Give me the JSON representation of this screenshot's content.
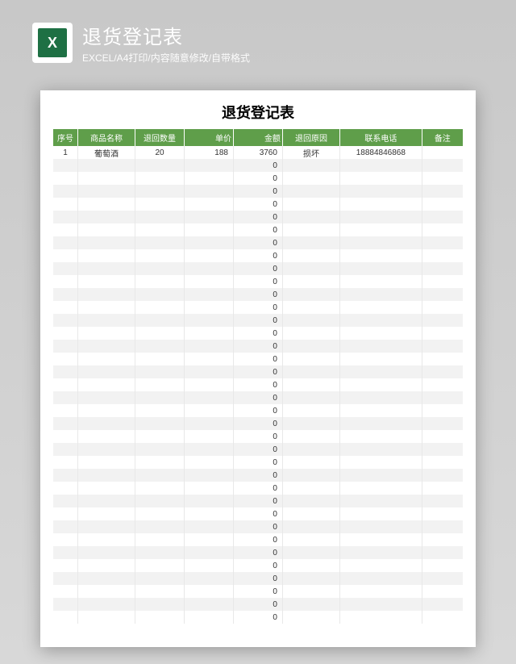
{
  "header": {
    "icon_text": "X",
    "title": "退货登记表",
    "subtitle": "EXCEL/A4打印/内容随意修改/自带格式"
  },
  "table": {
    "title": "退货登记表",
    "columns": [
      "序号",
      "商品名称",
      "退回数量",
      "单价",
      "金额",
      "退回原因",
      "联系电话",
      "备注"
    ],
    "rows": [
      {
        "seq": "1",
        "name": "葡萄酒",
        "qty": "20",
        "price": "188",
        "amount": "3760",
        "reason": "损坏",
        "phone": "18884846868",
        "note": ""
      },
      {
        "seq": "",
        "name": "",
        "qty": "",
        "price": "",
        "amount": "0",
        "reason": "",
        "phone": "",
        "note": ""
      },
      {
        "seq": "",
        "name": "",
        "qty": "",
        "price": "",
        "amount": "0",
        "reason": "",
        "phone": "",
        "note": ""
      },
      {
        "seq": "",
        "name": "",
        "qty": "",
        "price": "",
        "amount": "0",
        "reason": "",
        "phone": "",
        "note": ""
      },
      {
        "seq": "",
        "name": "",
        "qty": "",
        "price": "",
        "amount": "0",
        "reason": "",
        "phone": "",
        "note": ""
      },
      {
        "seq": "",
        "name": "",
        "qty": "",
        "price": "",
        "amount": "0",
        "reason": "",
        "phone": "",
        "note": ""
      },
      {
        "seq": "",
        "name": "",
        "qty": "",
        "price": "",
        "amount": "0",
        "reason": "",
        "phone": "",
        "note": ""
      },
      {
        "seq": "",
        "name": "",
        "qty": "",
        "price": "",
        "amount": "0",
        "reason": "",
        "phone": "",
        "note": ""
      },
      {
        "seq": "",
        "name": "",
        "qty": "",
        "price": "",
        "amount": "0",
        "reason": "",
        "phone": "",
        "note": ""
      },
      {
        "seq": "",
        "name": "",
        "qty": "",
        "price": "",
        "amount": "0",
        "reason": "",
        "phone": "",
        "note": ""
      },
      {
        "seq": "",
        "name": "",
        "qty": "",
        "price": "",
        "amount": "0",
        "reason": "",
        "phone": "",
        "note": ""
      },
      {
        "seq": "",
        "name": "",
        "qty": "",
        "price": "",
        "amount": "0",
        "reason": "",
        "phone": "",
        "note": ""
      },
      {
        "seq": "",
        "name": "",
        "qty": "",
        "price": "",
        "amount": "0",
        "reason": "",
        "phone": "",
        "note": ""
      },
      {
        "seq": "",
        "name": "",
        "qty": "",
        "price": "",
        "amount": "0",
        "reason": "",
        "phone": "",
        "note": ""
      },
      {
        "seq": "",
        "name": "",
        "qty": "",
        "price": "",
        "amount": "0",
        "reason": "",
        "phone": "",
        "note": ""
      },
      {
        "seq": "",
        "name": "",
        "qty": "",
        "price": "",
        "amount": "0",
        "reason": "",
        "phone": "",
        "note": ""
      },
      {
        "seq": "",
        "name": "",
        "qty": "",
        "price": "",
        "amount": "0",
        "reason": "",
        "phone": "",
        "note": ""
      },
      {
        "seq": "",
        "name": "",
        "qty": "",
        "price": "",
        "amount": "0",
        "reason": "",
        "phone": "",
        "note": ""
      },
      {
        "seq": "",
        "name": "",
        "qty": "",
        "price": "",
        "amount": "0",
        "reason": "",
        "phone": "",
        "note": ""
      },
      {
        "seq": "",
        "name": "",
        "qty": "",
        "price": "",
        "amount": "0",
        "reason": "",
        "phone": "",
        "note": ""
      },
      {
        "seq": "",
        "name": "",
        "qty": "",
        "price": "",
        "amount": "0",
        "reason": "",
        "phone": "",
        "note": ""
      },
      {
        "seq": "",
        "name": "",
        "qty": "",
        "price": "",
        "amount": "0",
        "reason": "",
        "phone": "",
        "note": ""
      },
      {
        "seq": "",
        "name": "",
        "qty": "",
        "price": "",
        "amount": "0",
        "reason": "",
        "phone": "",
        "note": ""
      },
      {
        "seq": "",
        "name": "",
        "qty": "",
        "price": "",
        "amount": "0",
        "reason": "",
        "phone": "",
        "note": ""
      },
      {
        "seq": "",
        "name": "",
        "qty": "",
        "price": "",
        "amount": "0",
        "reason": "",
        "phone": "",
        "note": ""
      },
      {
        "seq": "",
        "name": "",
        "qty": "",
        "price": "",
        "amount": "0",
        "reason": "",
        "phone": "",
        "note": ""
      },
      {
        "seq": "",
        "name": "",
        "qty": "",
        "price": "",
        "amount": "0",
        "reason": "",
        "phone": "",
        "note": ""
      },
      {
        "seq": "",
        "name": "",
        "qty": "",
        "price": "",
        "amount": "0",
        "reason": "",
        "phone": "",
        "note": ""
      },
      {
        "seq": "",
        "name": "",
        "qty": "",
        "price": "",
        "amount": "0",
        "reason": "",
        "phone": "",
        "note": ""
      },
      {
        "seq": "",
        "name": "",
        "qty": "",
        "price": "",
        "amount": "0",
        "reason": "",
        "phone": "",
        "note": ""
      },
      {
        "seq": "",
        "name": "",
        "qty": "",
        "price": "",
        "amount": "0",
        "reason": "",
        "phone": "",
        "note": ""
      },
      {
        "seq": "",
        "name": "",
        "qty": "",
        "price": "",
        "amount": "0",
        "reason": "",
        "phone": "",
        "note": ""
      },
      {
        "seq": "",
        "name": "",
        "qty": "",
        "price": "",
        "amount": "0",
        "reason": "",
        "phone": "",
        "note": ""
      },
      {
        "seq": "",
        "name": "",
        "qty": "",
        "price": "",
        "amount": "0",
        "reason": "",
        "phone": "",
        "note": ""
      },
      {
        "seq": "",
        "name": "",
        "qty": "",
        "price": "",
        "amount": "0",
        "reason": "",
        "phone": "",
        "note": ""
      },
      {
        "seq": "",
        "name": "",
        "qty": "",
        "price": "",
        "amount": "0",
        "reason": "",
        "phone": "",
        "note": ""
      },
      {
        "seq": "",
        "name": "",
        "qty": "",
        "price": "",
        "amount": "0",
        "reason": "",
        "phone": "",
        "note": ""
      }
    ]
  }
}
